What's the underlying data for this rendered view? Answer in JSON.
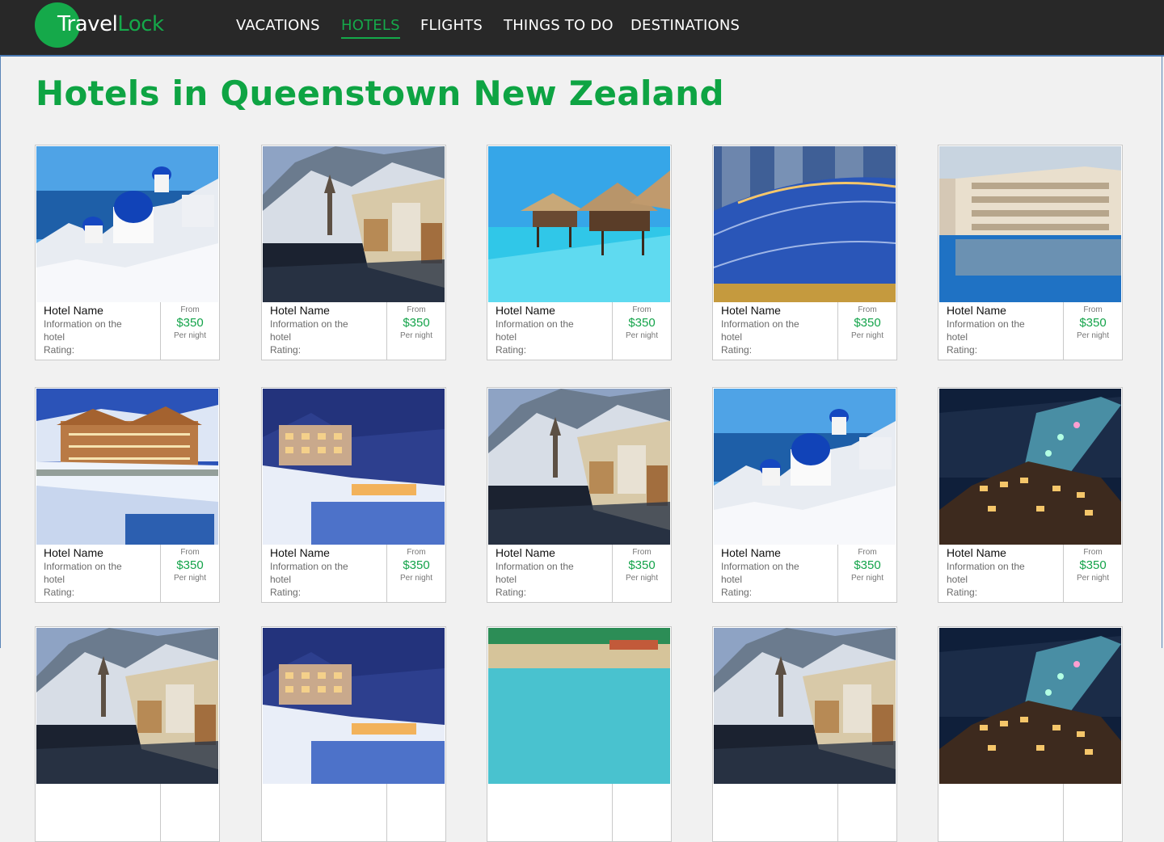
{
  "brand": {
    "part1": "Travel",
    "part2": "Lock",
    "accent": "#15a94a"
  },
  "nav": [
    {
      "label": "VACATIONS",
      "active": false
    },
    {
      "label": "HOTELS",
      "active": true
    },
    {
      "label": "FLIGHTS",
      "active": false
    },
    {
      "label": "THINGS TO DO",
      "active": false
    },
    {
      "label": "DESTINATIONS",
      "active": false
    }
  ],
  "page": {
    "title": "Hotels in Queenstown New Zealand"
  },
  "cards": [
    {
      "name": "Hotel Name",
      "info": "Information on the hotel",
      "rating": "Rating:",
      "from": "From",
      "price": "$350",
      "per": "Per night",
      "photo": "santorini"
    },
    {
      "name": "Hotel Name",
      "info": "Information on the hotel",
      "rating": "Rating:",
      "from": "From",
      "price": "$350",
      "per": "Per night",
      "photo": "alpine-village"
    },
    {
      "name": "Hotel Name",
      "info": "Information on the hotel",
      "rating": "Rating:",
      "from": "From",
      "price": "$350",
      "per": "Per night",
      "photo": "overwater-bungalows"
    },
    {
      "name": "Hotel Name",
      "info": "Information on the hotel",
      "rating": "Rating:",
      "from": "From",
      "price": "$350",
      "per": "Per night",
      "photo": "city-hotel"
    },
    {
      "name": "Hotel Name",
      "info": "Information on the hotel",
      "rating": "Rating:",
      "from": "From",
      "price": "$350",
      "per": "Per night",
      "photo": "pool-resort"
    },
    {
      "name": "Hotel Name",
      "info": "Information on the hotel",
      "rating": "Rating:",
      "from": "From",
      "price": "$350",
      "per": "Per night",
      "photo": "snow-chalet"
    },
    {
      "name": "Hotel Name",
      "info": "Information on the hotel",
      "rating": "Rating:",
      "from": "From",
      "price": "$350",
      "per": "Per night",
      "photo": "night-hotel"
    },
    {
      "name": "Hotel Name",
      "info": "Information on the hotel",
      "rating": "Rating:",
      "from": "From",
      "price": "$350",
      "per": "Per night",
      "photo": "alpine-village"
    },
    {
      "name": "Hotel Name",
      "info": "Information on the hotel",
      "rating": "Rating:",
      "from": "From",
      "price": "$350",
      "per": "Per night",
      "photo": "santorini"
    },
    {
      "name": "Hotel Name",
      "info": "Information on the hotel",
      "rating": "Rating:",
      "from": "From",
      "price": "$350",
      "per": "Per night",
      "photo": "night-ski-lodge"
    },
    {
      "name": "",
      "info": "",
      "rating": "",
      "from": "",
      "price": "",
      "per": "",
      "photo": "alpine-village"
    },
    {
      "name": "",
      "info": "",
      "rating": "",
      "from": "",
      "price": "",
      "per": "",
      "photo": "night-hotel"
    },
    {
      "name": "",
      "info": "",
      "rating": "",
      "from": "",
      "price": "",
      "per": "",
      "photo": "tropical-coast"
    },
    {
      "name": "",
      "info": "",
      "rating": "",
      "from": "",
      "price": "",
      "per": "",
      "photo": "alpine-village"
    },
    {
      "name": "",
      "info": "",
      "rating": "",
      "from": "",
      "price": "",
      "per": "",
      "photo": "night-ski-lodge"
    }
  ]
}
